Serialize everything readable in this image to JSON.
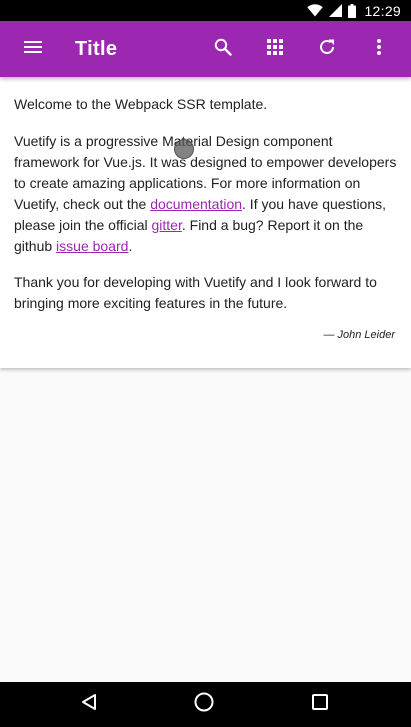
{
  "status_bar": {
    "time": "12:29",
    "icons": [
      "wifi-icon",
      "cell-signal-icon",
      "battery-icon"
    ]
  },
  "app_bar": {
    "title": "Title",
    "color": "#9c27b0",
    "icons": [
      "menu-icon",
      "search-icon",
      "apps-grid-icon",
      "refresh-icon",
      "more-vert-icon"
    ]
  },
  "content": {
    "welcome": "Welcome to the Webpack SSR template.",
    "para2": {
      "text1": "Vuetify is a progressive Material Design component framework for Vue.js. It was designed to empower developers to create amazing applications. For more information on Vuetify, check out the ",
      "link1": "documentation",
      "text2": ". If you have questions, please join the official ",
      "link2": "gitter",
      "text3": ". Find a bug? Report it on the github ",
      "link3": "issue board",
      "text4": "."
    },
    "para3": "Thank you for developing with Vuetify and I look forward to bringing more exciting features in the future.",
    "signature": "— John Leider",
    "link_color": "#9c27b0"
  },
  "nav_bar": {
    "icons": [
      "back-icon",
      "home-icon",
      "recents-icon"
    ]
  }
}
